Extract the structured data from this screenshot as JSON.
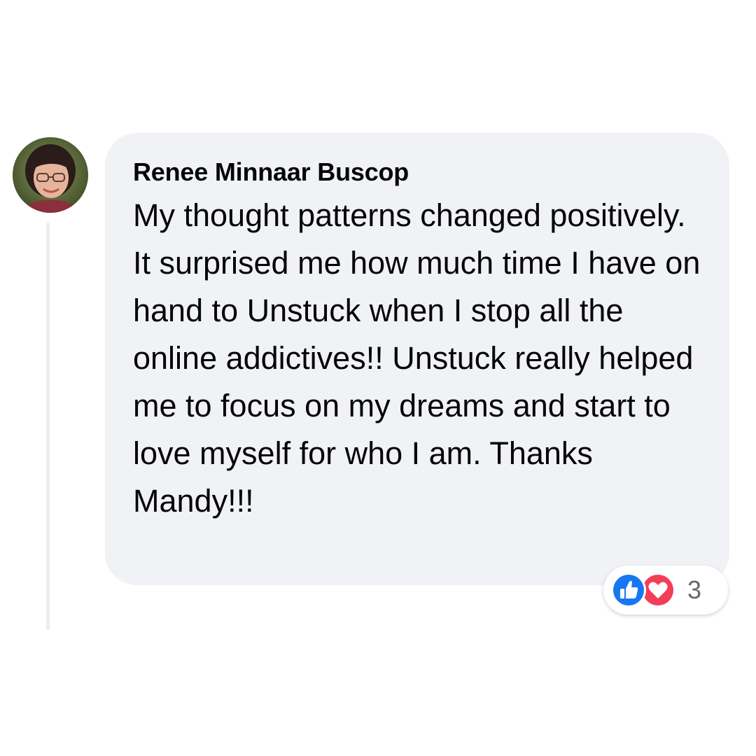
{
  "comment": {
    "author": "Renee Minnaar Buscop",
    "text": "My thought patterns changed positively. It surprised me how much time I have on hand to Unstuck when I stop all the online addictives!! Unstuck really helped me to focus on my dreams and start to love myself for who I am. Thanks Mandy!!!",
    "avatar_icon": "profile-photo",
    "bubble_color": "#f0f2f5"
  },
  "reactions": {
    "icons": [
      "like-icon",
      "love-icon"
    ],
    "like_color": "#1877f2",
    "love_color": "#f33e58",
    "count": "3"
  }
}
